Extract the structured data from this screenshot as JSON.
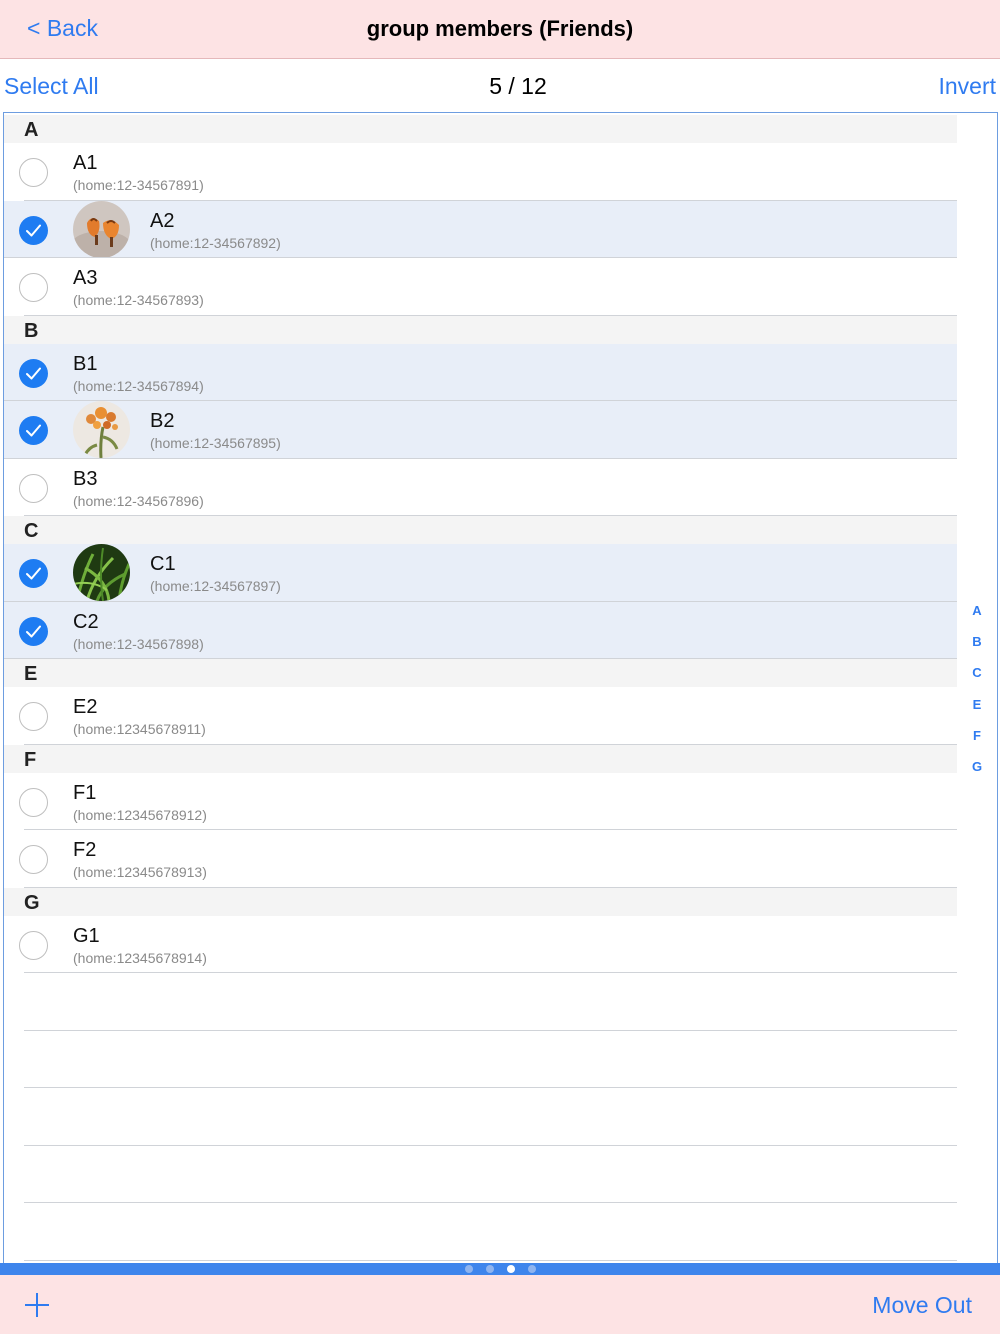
{
  "navbar": {
    "back_label": "< Back",
    "title": "group members (Friends)"
  },
  "toolbar": {
    "select_all_label": "Select All",
    "counter": "5 / 12",
    "invert_label": "Invert"
  },
  "sections": [
    {
      "letter": "A",
      "rows": [
        {
          "name": "A1",
          "phone": "(home:12-34567891)",
          "selected": false,
          "avatar": null
        },
        {
          "name": "A2",
          "phone": "(home:12-34567892)",
          "selected": true,
          "avatar": "flower-orange"
        },
        {
          "name": "A3",
          "phone": "(home:12-34567893)",
          "selected": false,
          "avatar": null
        }
      ]
    },
    {
      "letter": "B",
      "rows": [
        {
          "name": "B1",
          "phone": "(home:12-34567894)",
          "selected": true,
          "avatar": null
        },
        {
          "name": "B2",
          "phone": "(home:12-34567895)",
          "selected": true,
          "avatar": "flower-stem"
        },
        {
          "name": "B3",
          "phone": "(home:12-34567896)",
          "selected": false,
          "avatar": null
        }
      ]
    },
    {
      "letter": "C",
      "rows": [
        {
          "name": "C1",
          "phone": "(home:12-34567897)",
          "selected": true,
          "avatar": "grass"
        },
        {
          "name": "C2",
          "phone": "(home:12-34567898)",
          "selected": true,
          "avatar": null
        }
      ]
    },
    {
      "letter": "E",
      "rows": [
        {
          "name": "E2",
          "phone": "(home:12345678911)",
          "selected": false,
          "avatar": null
        }
      ]
    },
    {
      "letter": "F",
      "rows": [
        {
          "name": "F1",
          "phone": "(home:12345678912)",
          "selected": false,
          "avatar": null
        },
        {
          "name": "F2",
          "phone": "(home:12345678913)",
          "selected": false,
          "avatar": null
        }
      ]
    },
    {
      "letter": "G",
      "rows": [
        {
          "name": "G1",
          "phone": "(home:12345678914)",
          "selected": false,
          "avatar": null
        }
      ]
    }
  ],
  "section_index": [
    "A",
    "B",
    "C",
    "E",
    "F",
    "G"
  ],
  "pager": {
    "count": 4,
    "active": 3
  },
  "bottom": {
    "add_icon": "plus-icon",
    "move_out_label": "Move Out"
  },
  "colors": {
    "accent": "#2f7bf0",
    "bar_background": "#fde3e4",
    "selected_row": "#e8eef8",
    "check_fill": "#1e7cf2"
  }
}
